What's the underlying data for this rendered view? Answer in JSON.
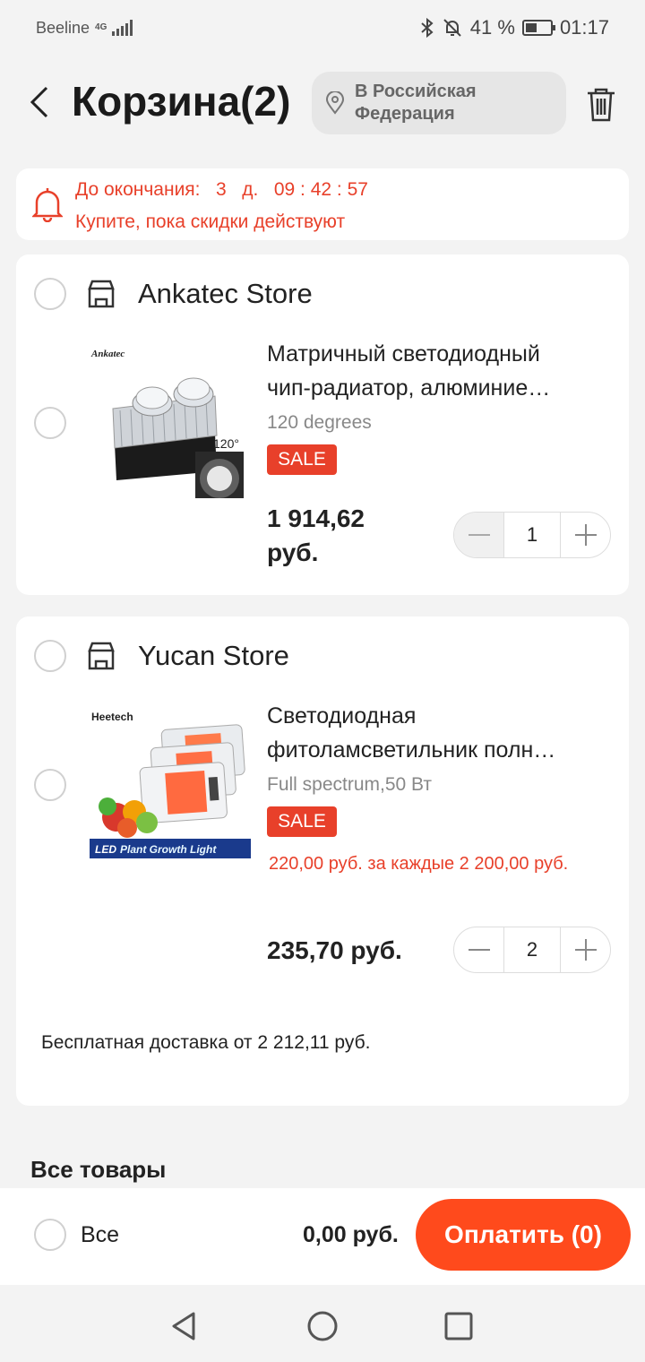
{
  "status_bar": {
    "carrier": "Beeline",
    "network": "4G",
    "battery_percent": "41 %",
    "time": "01:17"
  },
  "header": {
    "title": "Корзина(2)",
    "location": "В Российская Федерация"
  },
  "timer": {
    "label": "До окончания:",
    "days": "3",
    "days_unit": "д.",
    "hours": "09",
    "minutes": "42",
    "seconds": "57",
    "subtitle": "Купите, пока скидки действуют"
  },
  "stores": [
    {
      "name": "Ankatec Store",
      "product": {
        "image_brand": "Ankatec",
        "image_angle": "120°",
        "title_line1": "Матричный светодиодный",
        "title_line2": "чип-радиатор, алюминие…",
        "variant": "120 degrees",
        "badge": "SALE",
        "price_line1": "1 914,62",
        "price_line2": "руб.",
        "quantity": "1"
      }
    },
    {
      "name": "Yucan Store",
      "product": {
        "image_brand": "Heetech",
        "image_banner_led": "LED",
        "image_banner": "Plant Growth Light",
        "title_line1": "Светодиодная",
        "title_line2": "фитоламсветильник полн…",
        "variant": "Full spectrum,50 Вт",
        "badge": "SALE",
        "promo": "220,00 руб. за каждые 2 200,00 руб.",
        "price": "235,70 руб.",
        "quantity": "2"
      },
      "shipping_note": "Бесплатная доставка от 2 212,11 руб."
    }
  ],
  "all_items_title": "Все товары",
  "bottom_bar": {
    "select_all": "Все",
    "total": "0,00 руб.",
    "pay_button": "Оплатить (0)"
  },
  "colors": {
    "accent": "#e8402a",
    "pay_button": "#ff4a1c",
    "background": "#f3f3f3"
  }
}
